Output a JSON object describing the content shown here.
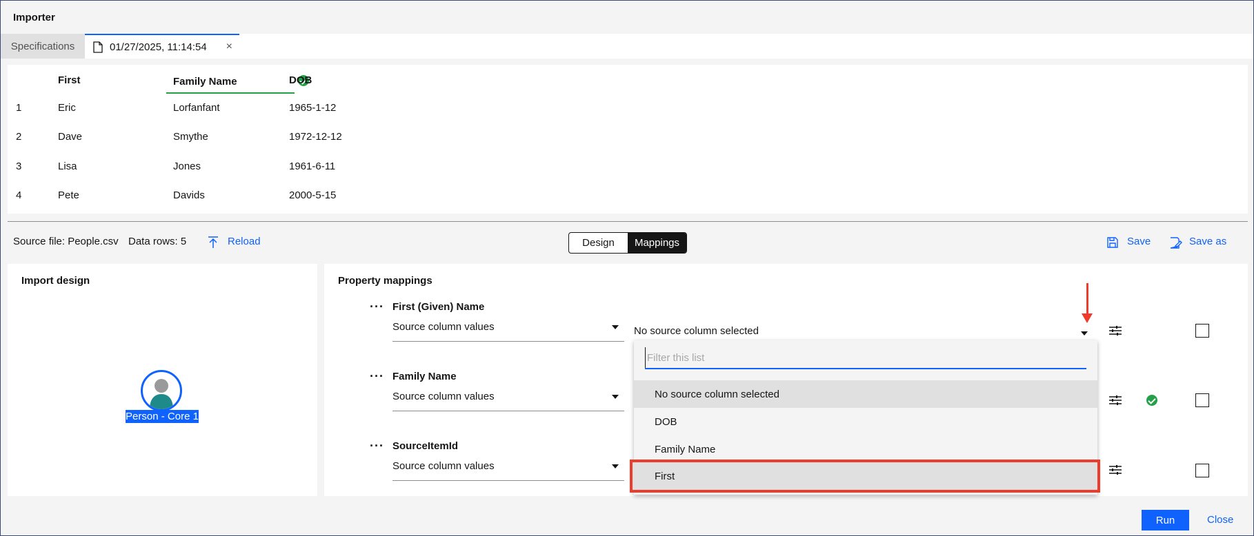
{
  "window": {
    "title": "Importer"
  },
  "tabs": [
    {
      "label": "Specifications"
    },
    {
      "label": "01/27/2025, 11:14:54",
      "close": "×"
    }
  ],
  "preview": {
    "headers": [
      "First",
      "Family Name",
      "DOB"
    ],
    "rows": [
      {
        "num": "1",
        "first": "Eric",
        "family": "Lorfanfant",
        "dob": "1965-1-12"
      },
      {
        "num": "2",
        "first": "Dave",
        "family": "Smythe",
        "dob": "1972-12-12"
      },
      {
        "num": "3",
        "first": "Lisa",
        "family": "Jones",
        "dob": "1961-6-11"
      },
      {
        "num": "4",
        "first": "Pete",
        "family": "Davids",
        "dob": "2000-5-15"
      }
    ]
  },
  "toolbar": {
    "source_file": "Source file: People.csv",
    "data_rows": "Data rows: 5",
    "reload": "Reload",
    "design": "Design",
    "mappings": "Mappings",
    "save": "Save",
    "save_as": "Save as"
  },
  "import_design": {
    "title": "Import design",
    "node_label": "Person - Core 1"
  },
  "property_mappings": {
    "title": "Property mappings",
    "rows": [
      {
        "name": "First (Given) Name",
        "mode": "Source column values",
        "source": "No source column selected"
      },
      {
        "name": "Family Name",
        "mode": "Source column values"
      },
      {
        "name": "SourceItemId",
        "mode": "Source column values"
      }
    ],
    "dropdown": {
      "placeholder": "Filter this list",
      "options": [
        "No source column selected",
        "DOB",
        "Family Name",
        "First"
      ]
    }
  },
  "footer": {
    "run": "Run",
    "close": "Close"
  },
  "colors": {
    "accent": "#0f62fe",
    "success": "#24a148",
    "highlight": "#ee3b2b"
  }
}
